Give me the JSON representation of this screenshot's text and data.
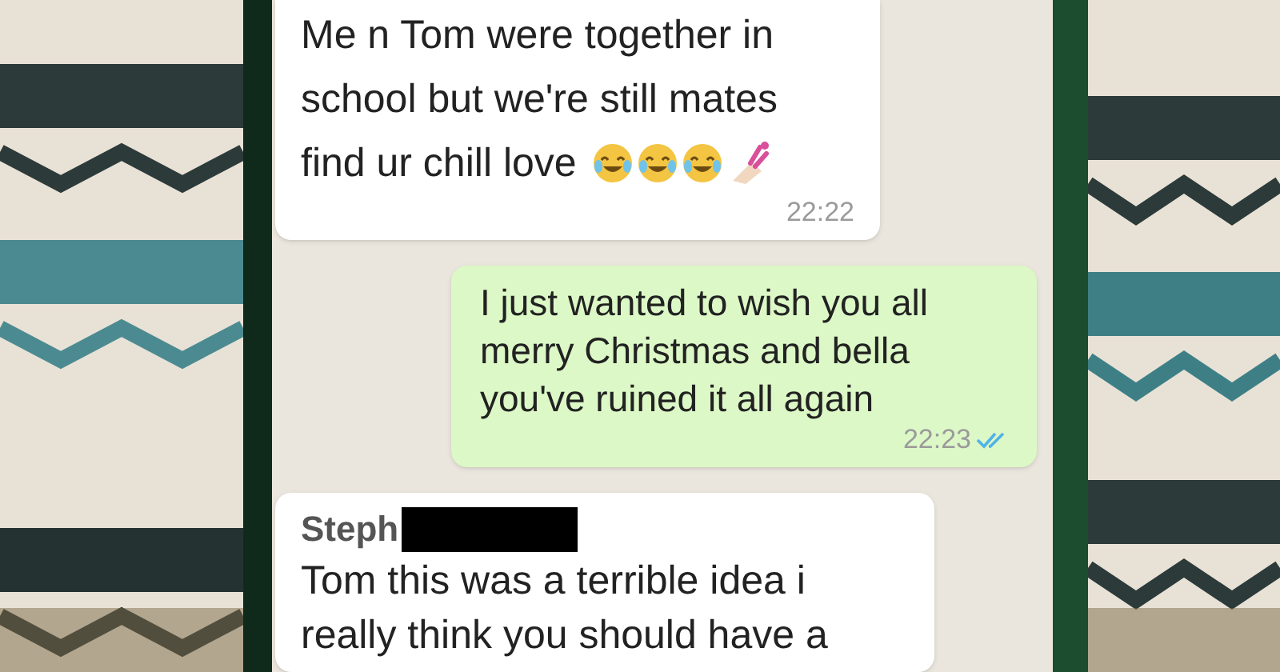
{
  "messages": [
    {
      "kind": "incoming",
      "text": [
        "Me n Tom were together in school but we're still mates",
        "find ur chill love"
      ],
      "emoji": [
        {
          "kind": "laughing"
        },
        {
          "kind": "laughing"
        },
        {
          "kind": "laughing"
        },
        {
          "kind": "nail_polish"
        }
      ],
      "time": "22:22"
    },
    {
      "kind": "outgoing",
      "text": [
        "I just wanted to wish you all merry Christmas and bella you've ruined it all again"
      ],
      "time": "22:23",
      "read": true
    },
    {
      "kind": "incoming",
      "sender": "Steph",
      "sender_redacted": true,
      "text": [
        "Tom this was a terrible idea i really think you should have a"
      ]
    }
  ]
}
